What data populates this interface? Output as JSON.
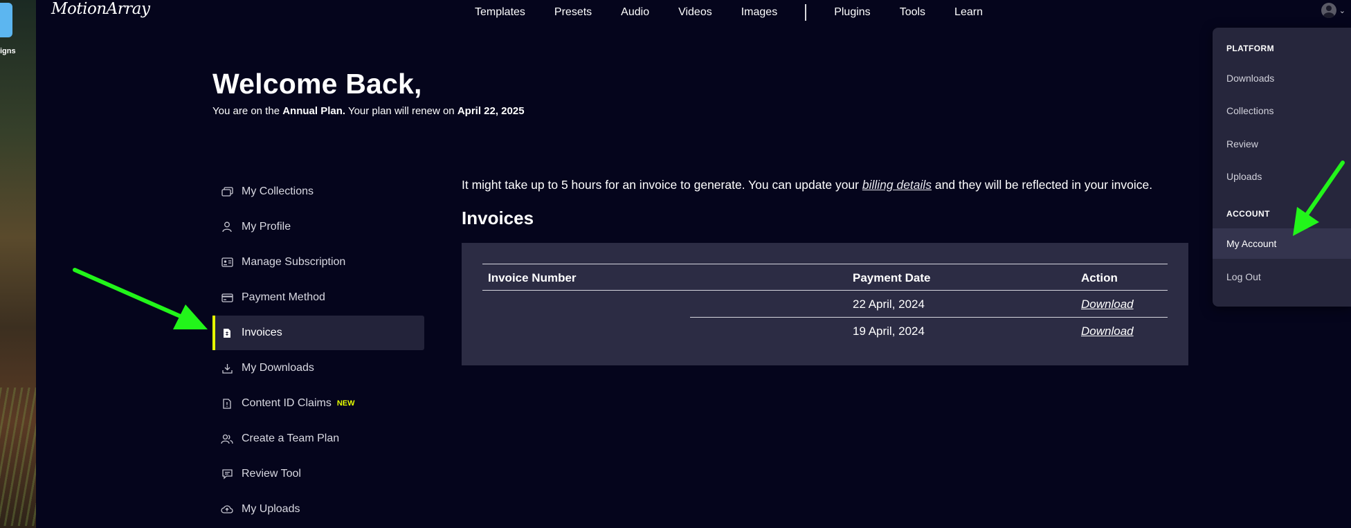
{
  "desktop": {
    "folder_label": "igns"
  },
  "header": {
    "logo": "MotionArray",
    "nav_left": [
      "Templates",
      "Presets",
      "Audio",
      "Videos",
      "Images"
    ],
    "nav_right": [
      "Plugins",
      "Tools",
      "Learn"
    ]
  },
  "welcome": {
    "title": "Welcome Back,",
    "plan_prefix": "You are on the ",
    "plan_name": "Annual Plan.",
    "plan_mid": " Your plan will renew on ",
    "renew_date": "April 22, 2025"
  },
  "sidebar": {
    "items": [
      {
        "label": "My Collections",
        "icon": "collections-icon"
      },
      {
        "label": "My Profile",
        "icon": "user-icon"
      },
      {
        "label": "Manage Subscription",
        "icon": "id-card-icon"
      },
      {
        "label": "Payment Method",
        "icon": "credit-card-icon"
      },
      {
        "label": "Invoices",
        "icon": "invoice-icon",
        "active": true
      },
      {
        "label": "My Downloads",
        "icon": "download-icon"
      },
      {
        "label": "Content ID Claims",
        "icon": "document-icon",
        "badge": "NEW"
      },
      {
        "label": "Create a Team Plan",
        "icon": "team-icon"
      },
      {
        "label": "Review Tool",
        "icon": "comment-icon"
      },
      {
        "label": "My Uploads",
        "icon": "cloud-upload-icon"
      }
    ]
  },
  "main": {
    "info_before": "It might take up to 5 hours for an invoice to generate. You can update your ",
    "info_link": "billing details",
    "info_after": " and they will be reflected in your invoice.",
    "title": "Invoices",
    "table": {
      "headers": [
        "Invoice Number",
        "Payment Date",
        "Action"
      ],
      "rows": [
        {
          "number": "",
          "date": "22 April, 2024",
          "action": "Download"
        },
        {
          "number": "",
          "date": "19 April, 2024",
          "action": "Download"
        }
      ]
    }
  },
  "dropdown": {
    "platform_heading": "PLATFORM",
    "platform_items": [
      "Downloads",
      "Collections",
      "Review",
      "Uploads"
    ],
    "account_heading": "ACCOUNT",
    "account_items": [
      "My Account",
      "Log Out"
    ]
  },
  "colors": {
    "background": "#05051c",
    "accent": "#e6ff00",
    "panel": "#2c2c44",
    "annotation_arrow": "#22f51a"
  }
}
